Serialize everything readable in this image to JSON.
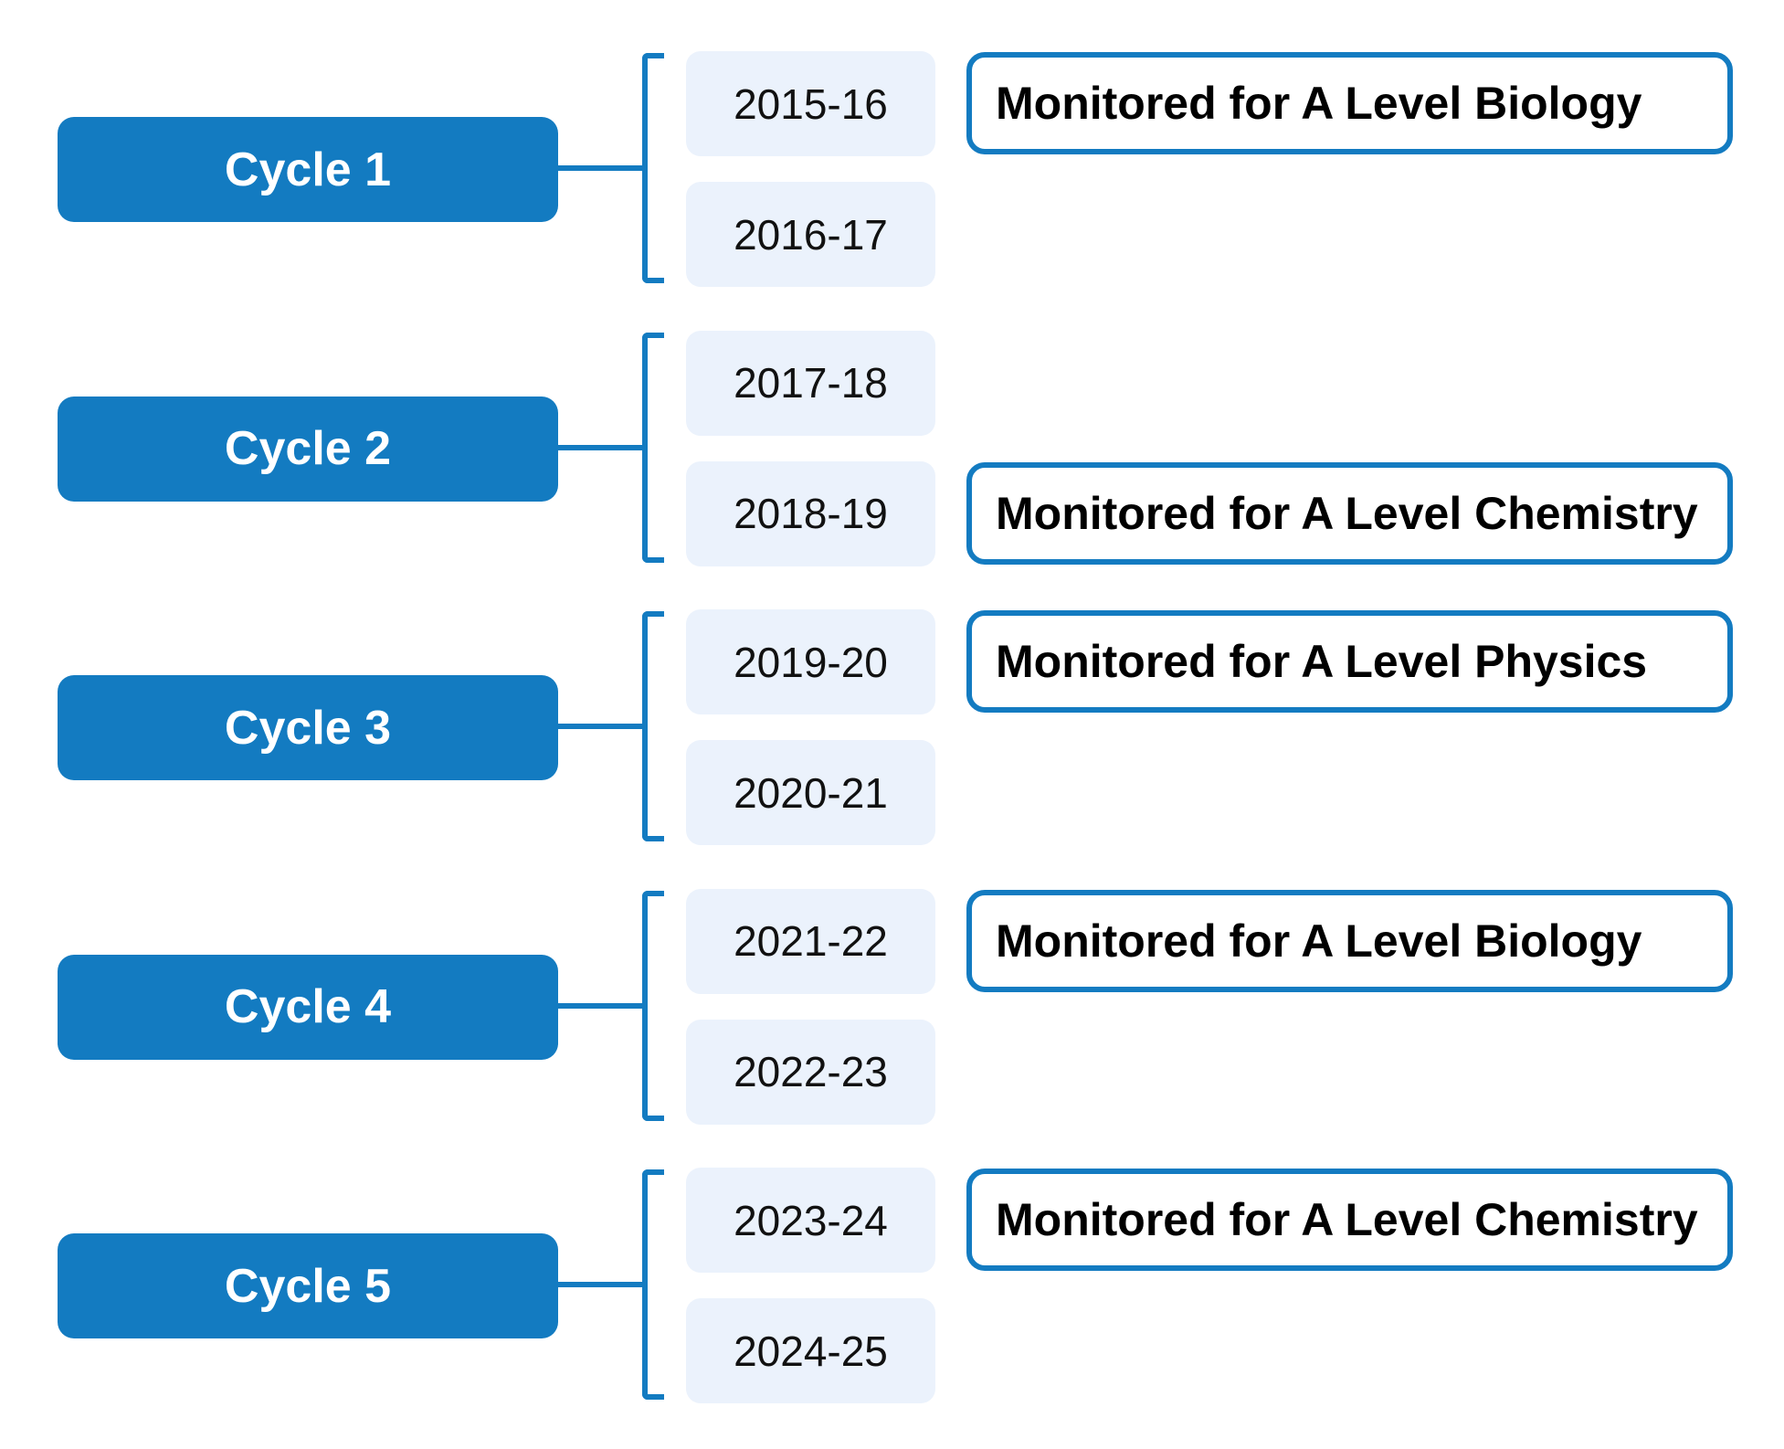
{
  "colors": {
    "accent": "#137BC1",
    "year_bg": "#EBF2FC"
  },
  "cycles": [
    {
      "label": "Cycle 1",
      "years": [
        "2015-16",
        "2016-17"
      ],
      "monitored": {
        "year_index": 0,
        "text": "Monitored for A Level Biology"
      }
    },
    {
      "label": "Cycle 2",
      "years": [
        "2017-18",
        "2018-19"
      ],
      "monitored": {
        "year_index": 1,
        "text": "Monitored for A Level Chemistry"
      }
    },
    {
      "label": "Cycle 3",
      "years": [
        "2019-20",
        "2020-21"
      ],
      "monitored": {
        "year_index": 0,
        "text": "Monitored for A Level Physics"
      }
    },
    {
      "label": "Cycle 4",
      "years": [
        "2021-22",
        "2022-23"
      ],
      "monitored": {
        "year_index": 0,
        "text": "Monitored for A Level Biology"
      }
    },
    {
      "label": "Cycle 5",
      "years": [
        "2023-24",
        "2024-25"
      ],
      "monitored": {
        "year_index": 0,
        "text": "Monitored for A Level Chemistry"
      }
    }
  ]
}
